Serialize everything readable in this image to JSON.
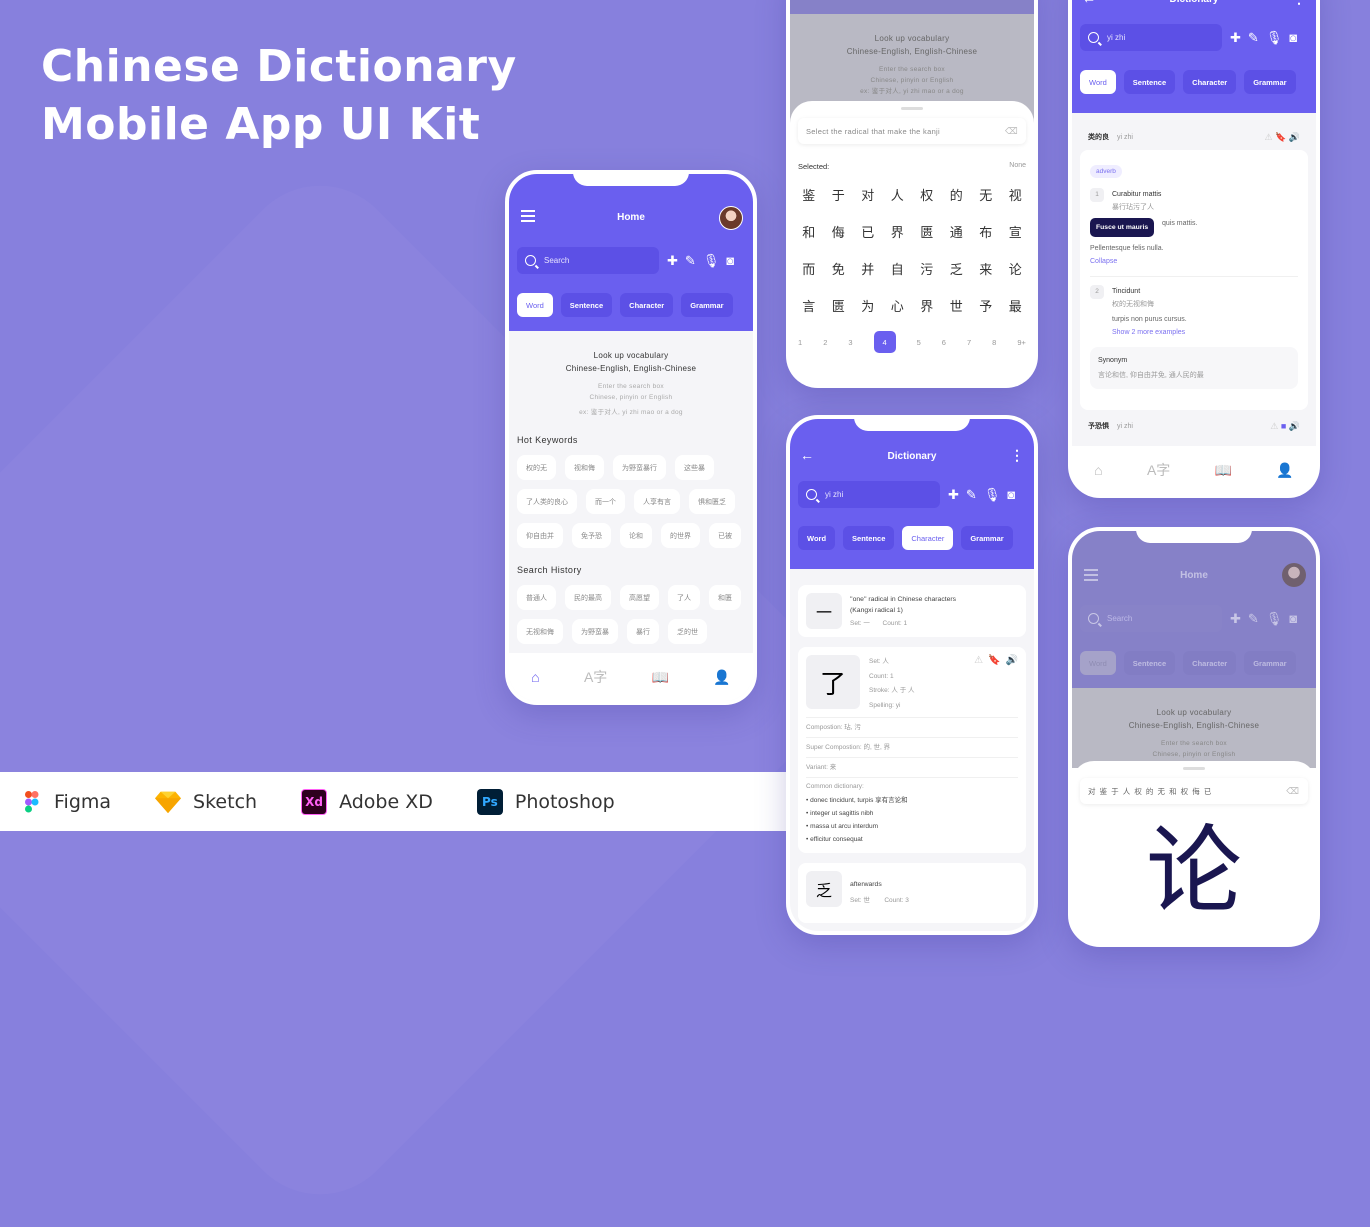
{
  "title": {
    "line1": "Chinese Dictionary",
    "line2": "Mobile App UI Kit"
  },
  "tools": [
    {
      "name": "Figma",
      "icon": "figma-icon"
    },
    {
      "name": "Sketch",
      "icon": "sketch-icon"
    },
    {
      "name": "Adobe XD",
      "icon": "xd-icon",
      "badge": "Xd"
    },
    {
      "name": "Photoshop",
      "icon": "ps-icon",
      "badge": "Ps"
    }
  ],
  "colors": {
    "accent": "#6a5fef",
    "background": "#8780dd",
    "tooltip": "#1a1650"
  },
  "common": {
    "tabs": [
      "Word",
      "Sentence",
      "Character",
      "Grammar"
    ],
    "search_placeholder": "Search",
    "look_up": "Look up vocabulary",
    "langs": "Chinese-English, English-Chinese",
    "hint1": "Enter the search box",
    "hint2": "Chinese, pinyin or English",
    "hint3": "ex: 鉴于对人, yi zhi mao or a dog"
  },
  "home": {
    "title": "Home",
    "hot_title": "Hot Keywords",
    "hot": [
      "权的无",
      "视和侮",
      "为野蛮暴行",
      "这些暴",
      "了人类的良心",
      "而一个",
      "人享有言",
      "惧和匮乏",
      "仰自由并",
      "免予恐",
      "论和",
      "的世界",
      "已被"
    ],
    "history_title": "Search History",
    "history": [
      "普通人",
      "民的最高",
      "高愿望",
      "了人",
      "和匮",
      "无视和侮",
      "为野蛮暴",
      "暴行",
      "乏的世"
    ]
  },
  "radical": {
    "placeholder": "Select the radical that make the kanji",
    "selected_label": "Selected:",
    "selected_value": "None",
    "grid": [
      "鉴",
      "于",
      "对",
      "人",
      "权",
      "的",
      "无",
      "视",
      "和",
      "侮",
      "已",
      "界",
      "匮",
      "通",
      "布",
      "宣",
      "而",
      "免",
      "并",
      "自",
      "污",
      "乏",
      "来",
      "论",
      "言",
      "匮",
      "为",
      "心",
      "界",
      "世",
      "予",
      "最"
    ],
    "pages": [
      "1",
      "2",
      "3",
      "4",
      "5",
      "6",
      "7",
      "8",
      "9+"
    ],
    "current_page": "4"
  },
  "character": {
    "title": "Dictionary",
    "query": "yi zhi",
    "active_tab": "Character",
    "radical_card": {
      "glyph": "一",
      "line1": "''one'' radical in Chinese characters",
      "line2": "(Kangxi radical 1)",
      "set": "Set: 一",
      "count": "Count: 1"
    },
    "detail": {
      "glyph": "了",
      "set": "Set:  人",
      "count": "Count:  1",
      "stroke": "Stroke:  人 于 人",
      "spelling": "Spelling:  yi",
      "composition": "Compostion:  玷, 污",
      "super": "Super Compostion:  的, 世, 界",
      "variant": "Variant:  来",
      "common_label": "Common dictionary:",
      "common": [
        "donec tincidunt, turpis 享有言论和",
        "integer ut sagittis nibh",
        "massa ut arcu interdum",
        "efficitur consequat"
      ]
    },
    "next_card": {
      "glyph": "乏",
      "word": "afterwards",
      "set": "Set:  世",
      "count": "Count: 3"
    }
  },
  "word": {
    "title": "Dictionary",
    "query": "yi zhi",
    "active_tab": "Word",
    "entry1": {
      "hanzi": "类的良",
      "pinyin": "yi zhi"
    },
    "pos": "adverb",
    "senses": [
      {
        "num": "1",
        "en": "Curabitur mattis",
        "zh": "暴行玷污了人",
        "ex": "quis mattis.",
        "ex2": "Pellentesque felis nulla.",
        "link": "Collapse"
      },
      {
        "num": "2",
        "en": "Tincidunt",
        "zh": "权的无视和侮",
        "ex": "turpis non purus cursus.",
        "link": "Show 2 more examples"
      }
    ],
    "tooltip": "Fusce ut mauris",
    "synonym_title": "Synonym",
    "synonym_text": "言论和信, 仰自由并免, 通人民的最",
    "entry2": {
      "hanzi": "予恐惧",
      "pinyin": "yi zhi"
    }
  },
  "draw": {
    "title": "Home",
    "input": "对 鉴 于 人 权 的 无 和 权 侮 已",
    "big_char": "论"
  }
}
